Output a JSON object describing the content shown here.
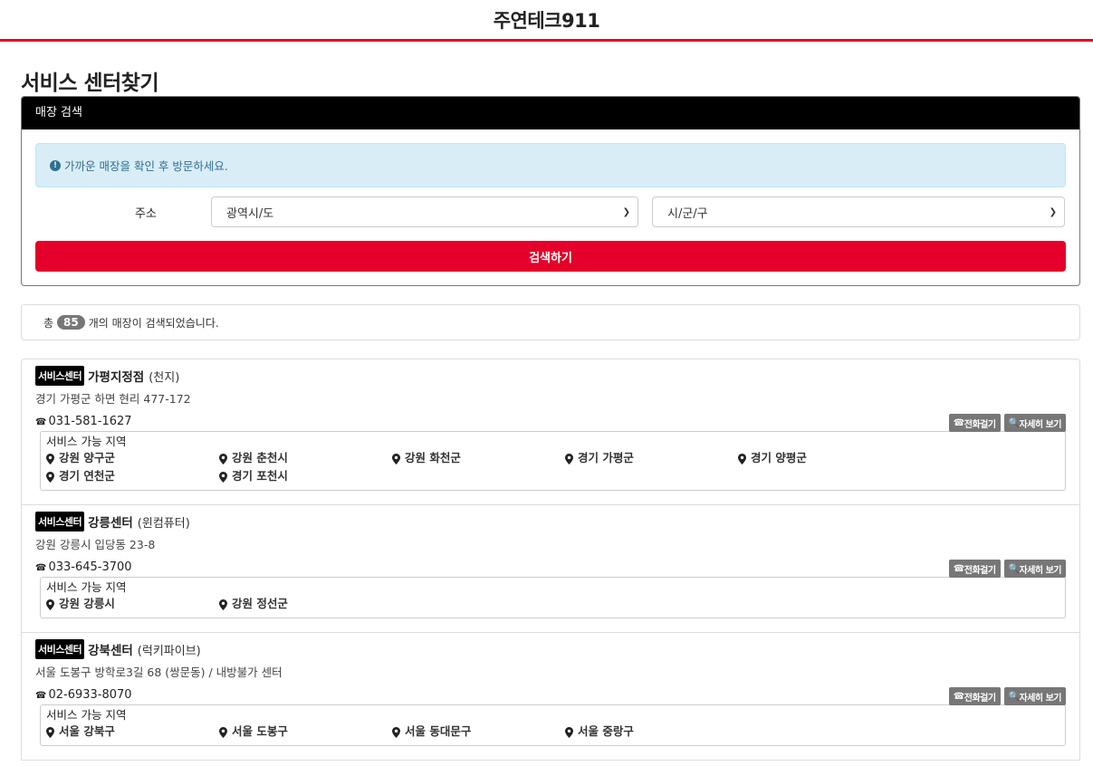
{
  "header": {
    "brand": "주연테크911"
  },
  "page_title": "서비스 센터찾기",
  "search": {
    "panel_title": "매장 검색",
    "notice": "가까운 매장을 확인 후 방문하세요.",
    "address_label": "주소",
    "province_select": "광역시/도",
    "city_select": "시/군/구",
    "search_button": "검색하기"
  },
  "result": {
    "prefix": "총",
    "count": "85",
    "suffix": "개의 매장이 검색되었습니다."
  },
  "store_tag": "서비스센터",
  "call_label": "전화걸기",
  "detail_label": "자세히 보기",
  "areas_title": "서비스 가능 지역",
  "stores": [
    {
      "name": "가평지정점",
      "sub": "(천지)",
      "address": "경기 가평군 하면 현리 477-172",
      "phone": "031-581-1627",
      "areas": [
        "강원 양구군",
        "강원 춘천시",
        "강원 화천군",
        "경기 가평군",
        "경기 양평군",
        "경기 연천군",
        "경기 포천시"
      ]
    },
    {
      "name": "강릉센터",
      "sub": "(윈컴퓨터)",
      "address": "강원 강릉시 입당동 23-8",
      "phone": "033-645-3700",
      "areas": [
        "강원 강릉시",
        "강원 정선군"
      ]
    },
    {
      "name": "강북센터",
      "sub": "(럭키파이브)",
      "address": "서울 도봉구 방학로3길 68 (쌍문동) / 내방불가 센터",
      "phone": "02-6933-8070",
      "areas": [
        "서울 강북구",
        "서울 도봉구",
        "서울 동대문구",
        "서울 중랑구"
      ]
    }
  ]
}
